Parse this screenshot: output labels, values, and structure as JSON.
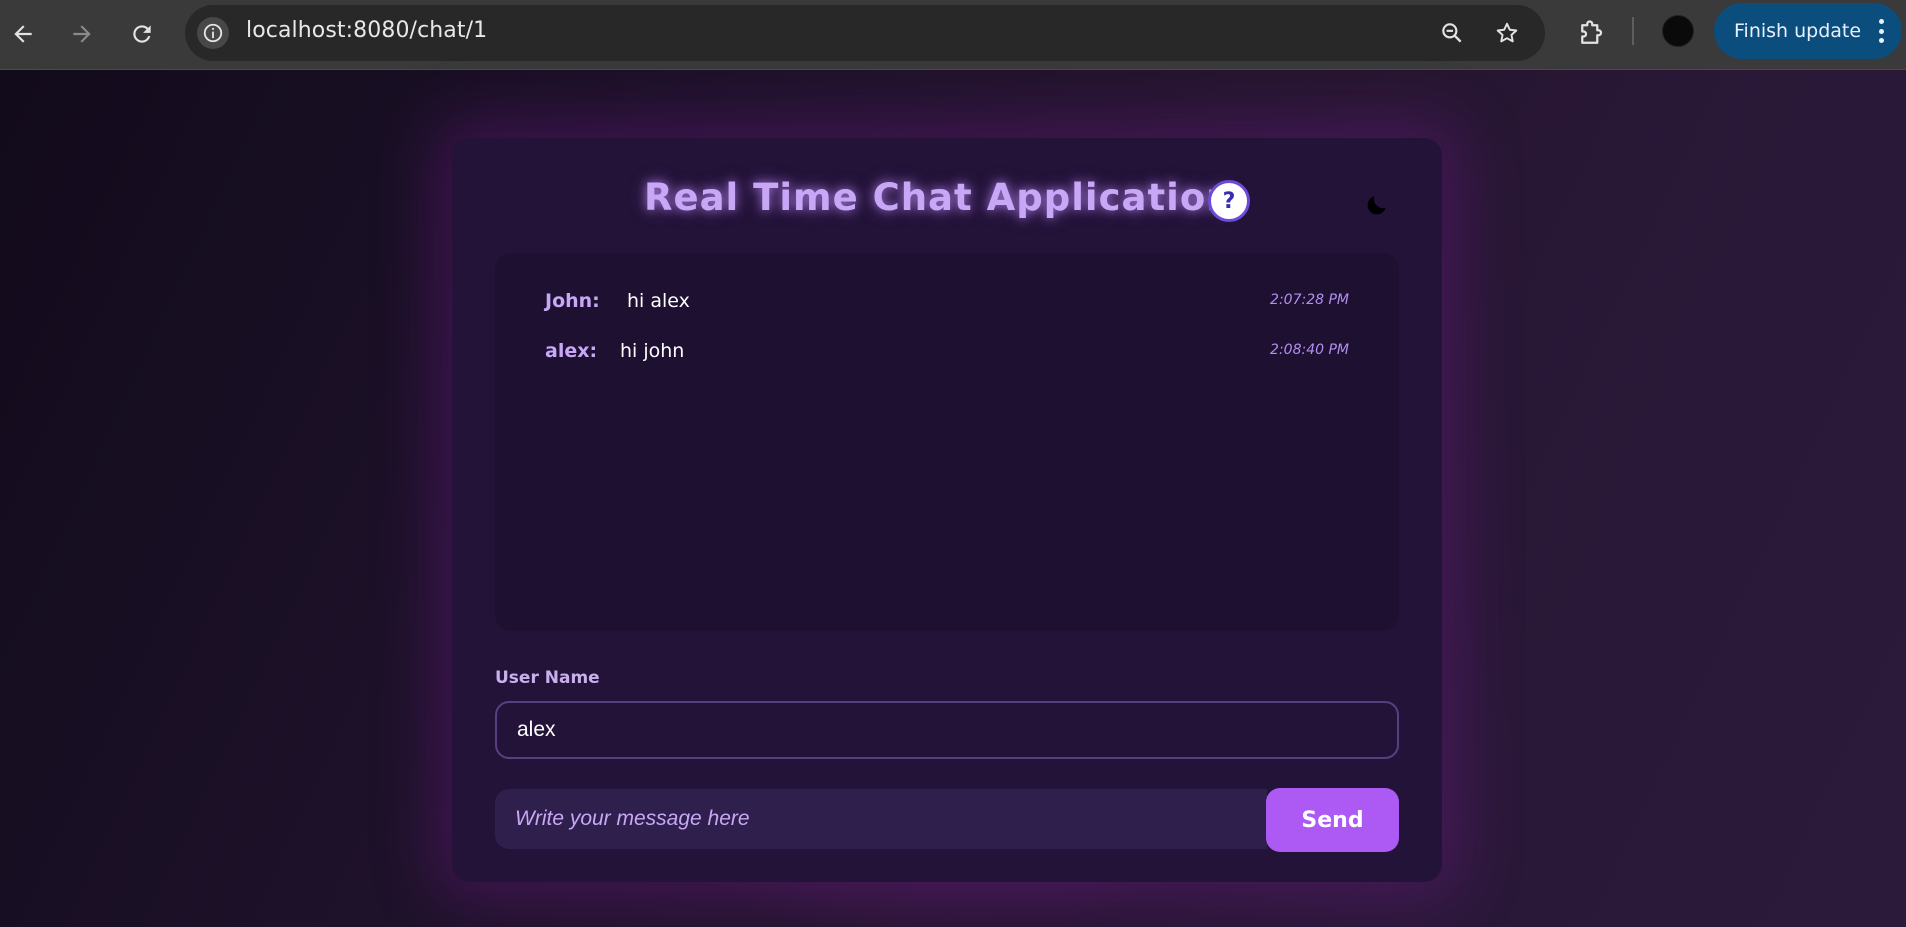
{
  "browser": {
    "url": "localhost:8080/chat/1",
    "finish_update_label": "Finish update",
    "icons": {
      "back": "arrow-left-icon",
      "forward": "arrow-right-icon",
      "reload": "reload-icon",
      "site_info": "info-icon",
      "zoom": "zoom-out-icon",
      "bookmark": "star-icon",
      "extensions": "puzzle-icon",
      "menu": "kebab-menu-icon"
    }
  },
  "app": {
    "title": "Real Time Chat Application",
    "help_symbol": "?",
    "theme_icon": "moon-icon",
    "messages": [
      {
        "sender": "John:",
        "text": "hi alex",
        "time": "2:07:28 PM"
      },
      {
        "sender": "alex:",
        "text": "hi john",
        "time": "2:08:40 PM"
      }
    ],
    "username_label": "User Name",
    "username_value": "alex",
    "message_placeholder": "Write your message here",
    "send_label": "Send"
  },
  "colors": {
    "accent": "#ad5af5",
    "title": "#c9a7f7",
    "card_bg": "#231338",
    "messages_bg": "#1d1030",
    "update_button": "#0b4d7d"
  }
}
